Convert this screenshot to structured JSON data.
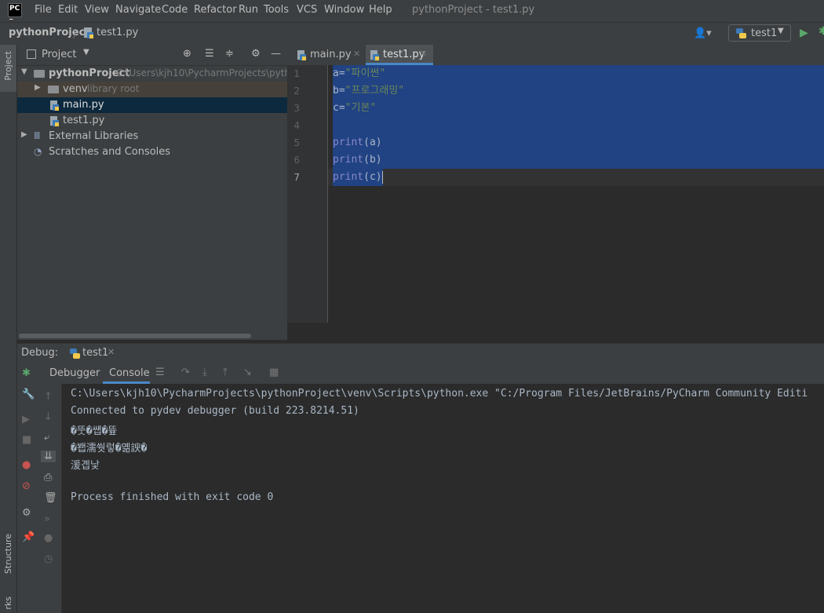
{
  "menubar": {
    "items": [
      "File",
      "Edit",
      "View",
      "Navigate",
      "Code",
      "Refactor",
      "Run",
      "Tools",
      "VCS",
      "Window",
      "Help"
    ],
    "window_title": "pythonProject - test1.py"
  },
  "navbar": {
    "project": "pythonProject",
    "file": "test1.py",
    "run_config": "test1"
  },
  "left_strip": {
    "project_tab": "Project",
    "structure_tab": "Structure",
    "bookmarks_tab": "rks"
  },
  "project_panel": {
    "title": "Project",
    "tree": [
      {
        "label": "pythonProject",
        "hint": "C:\\Users\\kjh10\\PycharmProjects\\pyth"
      },
      {
        "label": "venv",
        "hint": "library root"
      },
      {
        "label": "main.py",
        "hint": ""
      },
      {
        "label": "test1.py",
        "hint": ""
      },
      {
        "label": "External Libraries",
        "hint": ""
      },
      {
        "label": "Scratches and Consoles",
        "hint": ""
      }
    ]
  },
  "editor": {
    "tabs": [
      {
        "label": "main.py"
      },
      {
        "label": "test1.py"
      }
    ],
    "line_numbers": [
      "1",
      "2",
      "3",
      "4",
      "5",
      "6",
      "7"
    ],
    "code": {
      "l1_var": "a=",
      "l1_str": "\"파이썬\"",
      "l2_var": "b=",
      "l2_str": "\"프로그래밍\"",
      "l3_var": "c=",
      "l3_str": "\"기본\"",
      "l5_kw": "print",
      "l5_rest": "(a)",
      "l6_kw": "print",
      "l6_rest": "(b)",
      "l7_kw": "print",
      "l7_rest": "(c)"
    }
  },
  "debug": {
    "label": "Debug:",
    "session_tab": "test1",
    "tabs": {
      "debugger": "Debugger",
      "console": "Console"
    },
    "console_lines": [
      "C:\\Users\\kjh10\\PycharmProjects\\pythonProject\\venv\\Scripts\\python.exe \"C:/Program Files/JetBrains/PyCharm Community Editi",
      "Connected to pydev debugger (build 223.8214.51)",
      "�뚯�썝�뜦",
      "�봽濡쒓렇�옒諛�",
      "湲곕낯",
      "",
      "Process finished with exit code 0"
    ]
  },
  "colors": {
    "selection": "#214283",
    "string": "#6a8759",
    "keyword": "#8888c6",
    "run_green": "#59a869"
  }
}
